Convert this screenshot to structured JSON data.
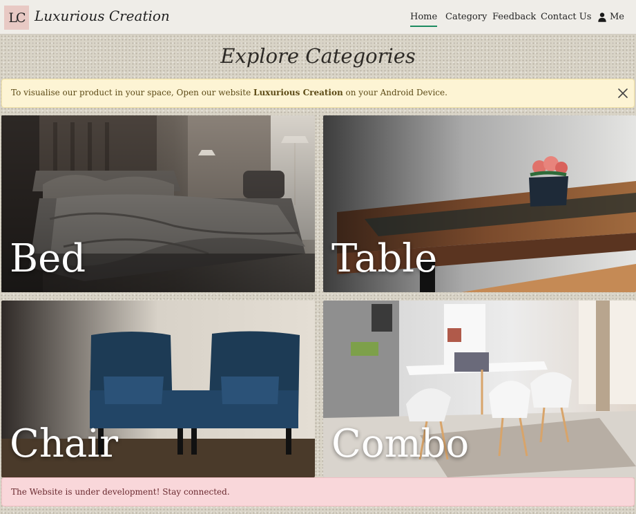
{
  "brand": {
    "logo_text": "LC",
    "name": "Luxurious Creation"
  },
  "nav": {
    "items": [
      {
        "label": "Home",
        "active": true
      },
      {
        "label": "Category",
        "active": false
      },
      {
        "label": "Feedback",
        "active": false
      },
      {
        "label": "Contact Us",
        "active": false
      },
      {
        "label": "Me",
        "active": false,
        "icon": "person-icon"
      }
    ]
  },
  "heading": "Explore Categories",
  "info_alert": {
    "text_before": "To visualise our product in your space, Open our website ",
    "brand": "Luxurious Creation",
    "text_after": " on your Android Device.",
    "close_icon": "close-icon"
  },
  "categories": [
    {
      "label": "Bed"
    },
    {
      "label": "Table"
    },
    {
      "label": "Chair"
    },
    {
      "label": "Combo"
    }
  ],
  "danger_alert": {
    "text": "The Website is under development! Stay connected."
  },
  "colors": {
    "navbar_bg": "#efede8",
    "active_underline": "#1b8a5f",
    "info_bg": "#fdf4d4",
    "danger_bg": "#f9d7da",
    "logo_bg": "#e8c9c4"
  }
}
